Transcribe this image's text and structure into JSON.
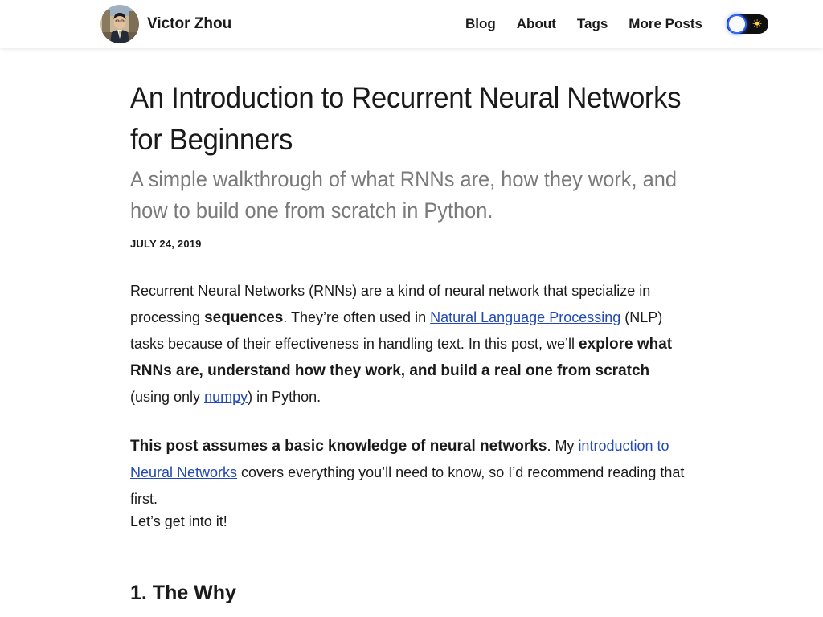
{
  "header": {
    "site_name": "Victor Zhou",
    "nav": [
      {
        "label": "Blog"
      },
      {
        "label": "About"
      },
      {
        "label": "Tags"
      },
      {
        "label": "More Posts"
      }
    ],
    "theme_toggle": {
      "icon": "sun-icon",
      "thumb_color": "#fafafa",
      "glow_color": "#3366ff"
    }
  },
  "article": {
    "title": "An Introduction to Recurrent Neural Networks for Beginners",
    "subtitle": "A simple walkthrough of what RNNs are, how they work, and how to build one from scratch in Python.",
    "date": "JULY 24, 2019",
    "p1": {
      "t1": "Recurrent Neural Networks (RNNs) are a kind of neural network that specialize in processing ",
      "b1": "sequences",
      "t2": ". They’re often used in ",
      "link1": "Natural Language Processing",
      "t3": " (NLP) tasks because of their effectiveness in handling text. In this post, we’ll ",
      "b2": "explore what RNNs are, understand how they work, and build a real one from scratch",
      "t4": " (using only ",
      "link2": "numpy",
      "t5": ") in Python."
    },
    "p2": {
      "b1": "This post assumes a basic knowledge of neural networks",
      "t1": ". My ",
      "link1": "introduction to Neural Networks",
      "t2": " covers everything you’ll need to know, so I’d recommend reading that first."
    },
    "p3": "Let’s get into it!",
    "section1_heading": "1. The Why"
  },
  "colors": {
    "link": "#2249b5",
    "subtitle": "#7a7a7a",
    "text": "#1a1a1a"
  }
}
